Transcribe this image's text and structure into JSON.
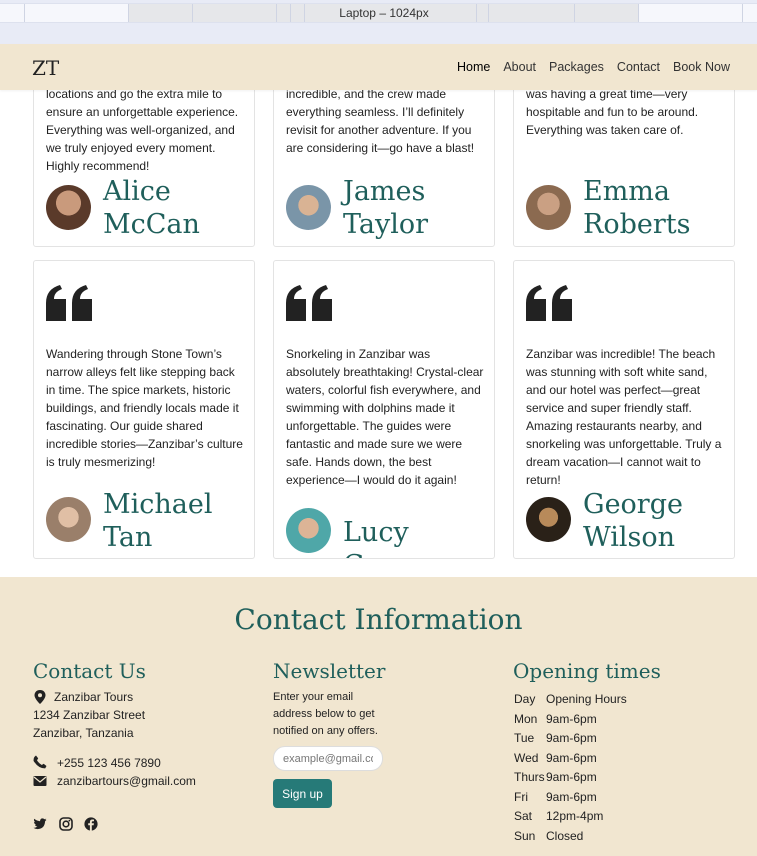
{
  "devtools": {
    "viewport_label": "Laptop – 1024px"
  },
  "navbar": {
    "brand": "ZT",
    "items": [
      {
        "label": "Home"
      },
      {
        "label": "About"
      },
      {
        "label": "Packages"
      },
      {
        "label": "Contact"
      },
      {
        "label": "Book Now"
      }
    ]
  },
  "testimonials": {
    "row1": [
      {
        "text": "locations and go the extra mile to ensure an unforgettable experience. Everything was well-organized, and we truly enjoyed every moment. Highly recommend!",
        "name": "Alice McCan"
      },
      {
        "text": "incredible, and the crew made everything seamless. I’ll definitely revisit for another adventure. If you are considering it—go have a blast!",
        "name": "James Taylor"
      },
      {
        "text": "was having a great time—very hospitable and fun to be around. Everything was taken care of.",
        "name": "Emma Roberts"
      }
    ],
    "row2": [
      {
        "text": "Wandering through Stone Town’s narrow alleys felt like stepping back in time. The spice markets, historic buildings, and friendly locals made it fascinating. Our guide shared incredible stories—Zanzibar’s culture is truly mesmerizing!",
        "name": "Michael Tan"
      },
      {
        "text": "Snorkeling in Zanzibar was absolutely breathtaking! Crystal-clear waters, colorful fish everywhere, and swimming with dolphins made it unforgettable. The guides were fantastic and made sure we were safe. Hands down, the best experience—I would do it again!",
        "name": "Lucy Green"
      },
      {
        "text": "Zanzibar was incredible! The beach was stunning with soft white sand, and our hotel was perfect—great service and super friendly staff. Amazing restaurants nearby, and snorkeling was unforgettable. Truly a dream vacation—I cannot wait to return!",
        "name": "George Wilson"
      }
    ]
  },
  "footer": {
    "title": "Contact Information",
    "contact": {
      "heading": "Contact Us",
      "company": "Zanzibar Tours",
      "street": "1234 Zanzibar Street",
      "city": "Zanzibar, Tanzania",
      "phone": "+255 123 456 7890",
      "email": "zanzibartours@gmail.com"
    },
    "newsletter": {
      "heading": "Newsletter",
      "text": "Enter your email address below to get notified on any offers.",
      "placeholder": "example@gmail.com",
      "button": "Sign up"
    },
    "hours": {
      "heading": "Opening times",
      "rows": [
        {
          "day": "Day",
          "time": "Opening Hours"
        },
        {
          "day": "Mon",
          "time": "9am-6pm"
        },
        {
          "day": "Tue",
          "time": "9am-6pm"
        },
        {
          "day": "Wed",
          "time": "9am-6pm"
        },
        {
          "day": "Thurs",
          "time": "9am-6pm"
        },
        {
          "day": "Fri",
          "time": "9am-6pm"
        },
        {
          "day": "Sat",
          "time": "12pm-4pm"
        },
        {
          "day": "Sun",
          "time": "Closed"
        }
      ]
    },
    "social_icons": [
      "twitter-icon",
      "instagram-icon",
      "facebook-icon"
    ]
  },
  "colors": {
    "accent": "#1f5f5b",
    "beige": "#f1e6d0",
    "button": "#267a78"
  }
}
